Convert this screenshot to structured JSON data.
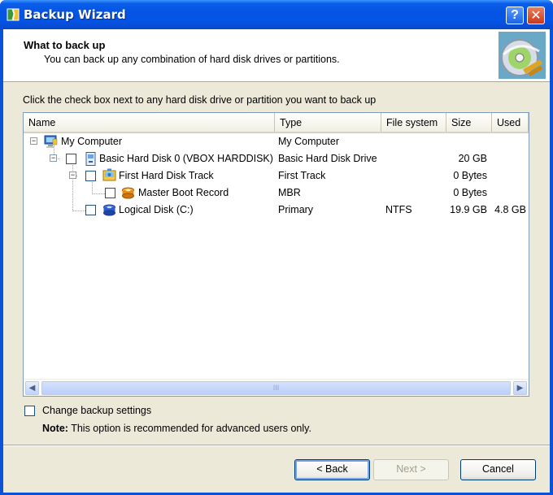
{
  "window": {
    "title": "Backup Wizard"
  },
  "header": {
    "title": "What to back up",
    "subtitle": "You can back up any combination of hard disk drives or partitions."
  },
  "instruction": "Click the check box next to any hard disk drive or partition you want to back up",
  "table": {
    "columns": [
      "Name",
      "Type",
      "File system",
      "Size",
      "Used"
    ],
    "rows": [
      {
        "name": "My Computer",
        "type": "My Computer",
        "fs": "",
        "size": "",
        "used": "",
        "icon": "computer-icon",
        "expander": "−",
        "checkbox": false
      },
      {
        "name": "Basic Hard Disk 0 (VBOX HARDDISK)",
        "type": "Basic Hard Disk Drive",
        "fs": "",
        "size": "20 GB",
        "used": "",
        "icon": "hard-disk-icon",
        "expander": "−",
        "checkbox": true
      },
      {
        "name": "First Hard Disk Track",
        "type": "First Track",
        "fs": "",
        "size": "0 Bytes",
        "used": "",
        "icon": "disk-track-icon",
        "expander": "−",
        "checkbox": true
      },
      {
        "name": "Master Boot Record",
        "type": "MBR",
        "fs": "",
        "size": "0 Bytes",
        "used": "",
        "icon": "mbr-icon",
        "expander": "",
        "checkbox": true
      },
      {
        "name": "Logical Disk (C:)",
        "type": "Primary",
        "fs": "NTFS",
        "size": "19.9 GB",
        "used": "4.8 GB",
        "icon": "logical-disk-icon",
        "expander": "",
        "checkbox": true
      }
    ],
    "scroll_grip": "III"
  },
  "options": {
    "change_settings_label": "Change backup settings",
    "note_label": "Note:",
    "note_text": "This option is recommended for advanced users only."
  },
  "buttons": {
    "back": "< Back",
    "next": "Next >",
    "cancel": "Cancel"
  },
  "titlebar_buttons": {
    "help": "?",
    "close": "✕"
  },
  "colors": {
    "titlebar": "#0554e3",
    "dialog_bg": "#ece9d8",
    "list_border": "#7f9db9"
  }
}
